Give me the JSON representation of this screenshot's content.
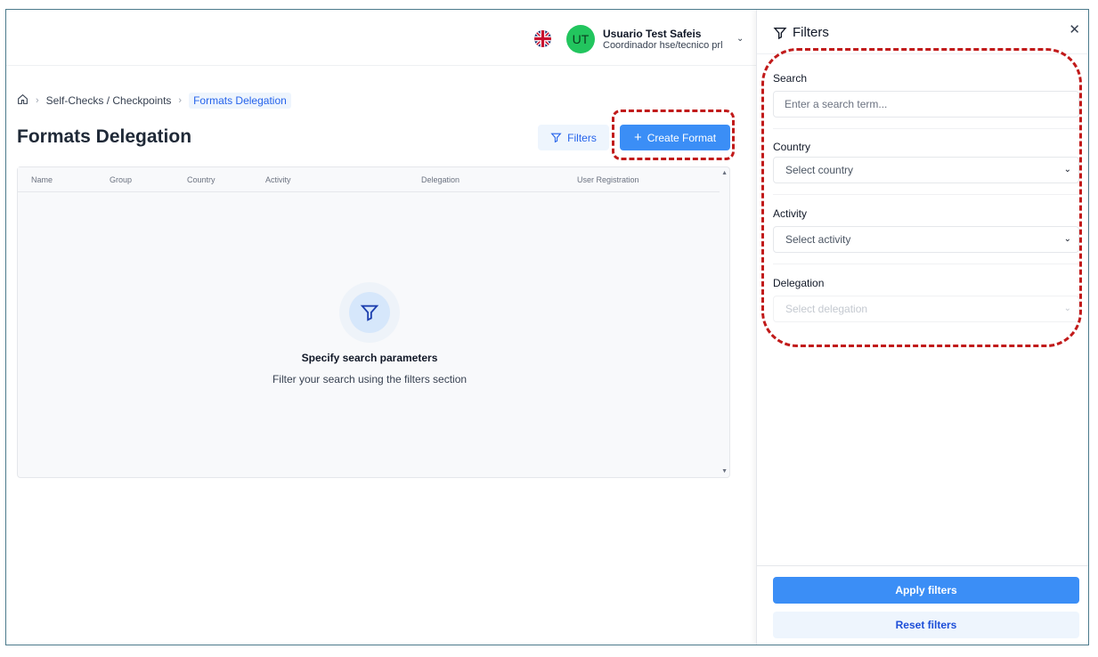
{
  "header": {
    "user_initials": "UT",
    "user_name": "Usuario Test Safeis",
    "user_role": "Coordinador hse/tecnico prl"
  },
  "breadcrumb": {
    "items": [
      "Self-Checks / Checkpoints",
      "Formats Delegation"
    ]
  },
  "page": {
    "title": "Formats Delegation",
    "filters_label": "Filters",
    "create_label": "Create Format"
  },
  "table": {
    "columns": [
      "Name",
      "Group",
      "Country",
      "Activity",
      "Delegation",
      "User Registration"
    ],
    "empty_title": "Specify search parameters",
    "empty_subtitle": "Filter your search using the filters section"
  },
  "filters_panel": {
    "title": "Filters",
    "search_label": "Search",
    "search_placeholder": "Enter a search term...",
    "country_label": "Country",
    "country_value": "Select country",
    "activity_label": "Activity",
    "activity_value": "Select activity",
    "delegation_label": "Delegation",
    "delegation_value": "Select delegation",
    "apply_label": "Apply filters",
    "reset_label": "Reset filters"
  },
  "colors": {
    "primary": "#3b8ef6",
    "highlight": "#c11a1a",
    "avatar": "#22c55e"
  }
}
